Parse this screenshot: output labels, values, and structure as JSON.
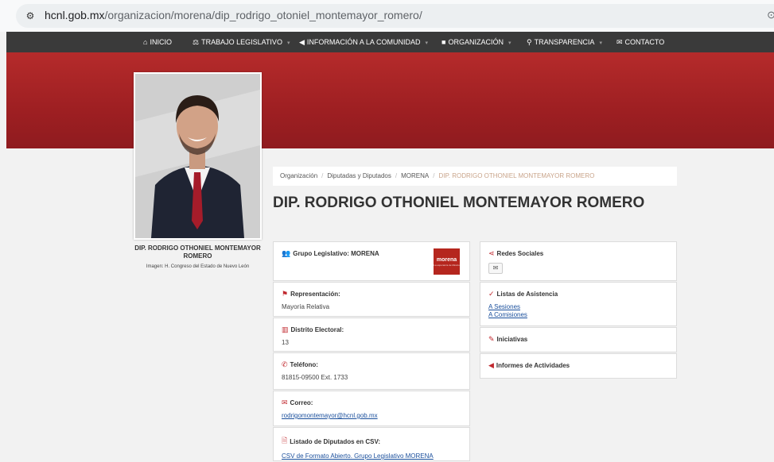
{
  "browser": {
    "url_host": "hcnl.gob.mx",
    "url_path": "/organizacion/morena/dip_rodrigo_otoniel_montemayor_romero/",
    "right_icon": "⊙"
  },
  "nav": {
    "items": [
      {
        "label": "INICIO",
        "icon": "home-icon"
      },
      {
        "label": "TRABAJO LEGISLATIVO",
        "icon": "balance-icon"
      },
      {
        "label": "INFORMACIÓN A LA COMUNIDAD",
        "icon": "megaphone-icon"
      },
      {
        "label": "ORGANIZACIÓN",
        "icon": "folder-icon"
      },
      {
        "label": "TRANSPARENCIA",
        "icon": "search-icon"
      },
      {
        "label": "CONTACTO",
        "icon": "envelope-icon"
      }
    ]
  },
  "profile": {
    "photo_name": "DIP. RODRIGO OTHONIEL MONTEMAYOR ROMERO",
    "photo_credit": "Imagen: H. Congreso del Estado de Nuevo León"
  },
  "breadcrumb": {
    "items": [
      "Organización",
      "Diputadas y Diputados",
      "MORENA"
    ],
    "active": "DIP. RODRIGO OTHONIEL MONTEMAYOR ROMERO"
  },
  "title": "DIP. RODRIGO OTHONIEL MONTEMAYOR ROMERO",
  "left_cards": {
    "grupo": {
      "label": "Grupo Legislativo: MORENA",
      "logo": "morena"
    },
    "representacion": {
      "label": "Representación:",
      "value": "Mayoría Relativa"
    },
    "distrito": {
      "label": "Distrito Electoral:",
      "value": "13"
    },
    "telefono": {
      "label": "Teléfono:",
      "value": "81815-09500 Ext. 1733"
    },
    "correo": {
      "label": "Correo:",
      "value": "rodrigomontemayor@hcnl.gob.mx"
    },
    "csv": {
      "label": "Listado de Diputados en CSV:",
      "value": "CSV de Formato Abierto. Grupo Legislativo MORENA"
    }
  },
  "right_cards": {
    "redes": {
      "label": "Redes Sociales"
    },
    "asistencia": {
      "label": "Listas de Asistencia",
      "links": [
        "A Sesiones",
        "A Comisiones"
      ]
    },
    "iniciativas": {
      "label": "Iniciativas"
    },
    "informes": {
      "label": "Informes de Actividades"
    }
  },
  "colors": {
    "accent": "#c0272d",
    "nav_bg": "#3a3a3a",
    "hero": "#a52326"
  }
}
